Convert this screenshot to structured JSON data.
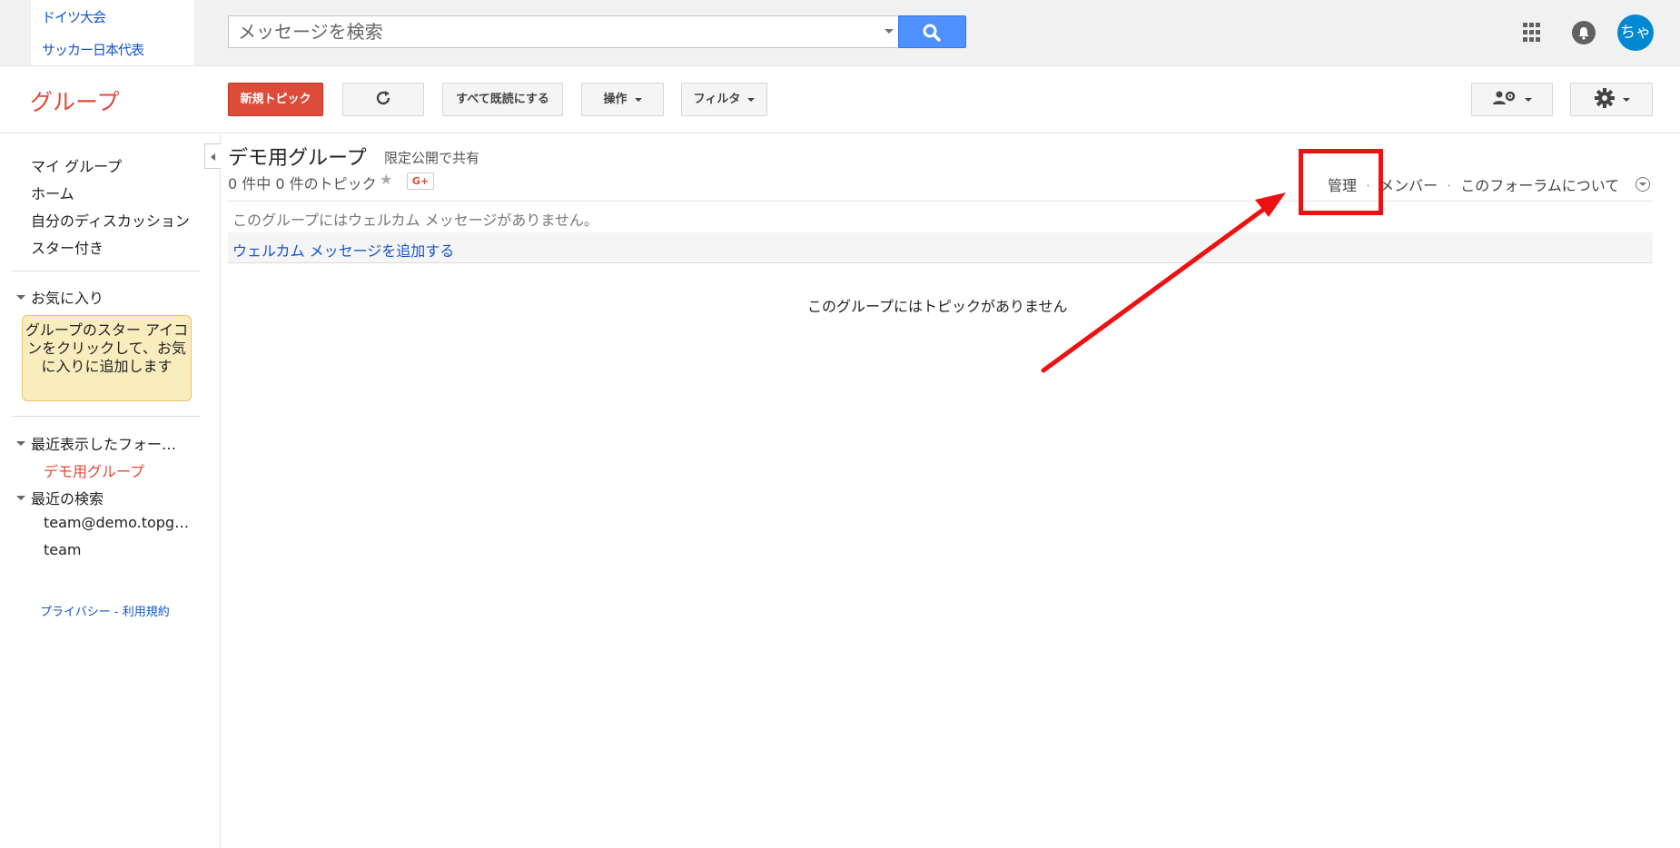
{
  "dropdown": {
    "items": [
      "ドイツ大会",
      "サッカー日本代表"
    ]
  },
  "search": {
    "placeholder": "メッセージを検索"
  },
  "user": {
    "avatar_text": "ちゃ"
  },
  "brand": {
    "title": "グループ"
  },
  "toolbar": {
    "new_topic": "新規トピック",
    "mark_all_read": "すべて既読にする",
    "actions": "操作",
    "filter": "フィルタ"
  },
  "sidebar": {
    "nav": [
      "マイ グループ",
      "ホーム",
      "自分のディスカッション",
      "スター付き"
    ],
    "favorites_header": "お気に入り",
    "favorites_tip": "グループのスター アイコンをクリックして、お気に入りに追加します",
    "recent_forums_header": "最近表示したフォー…",
    "recent_forums": [
      "デモ用グループ"
    ],
    "recent_search_header": "最近の検索",
    "recent_searches": [
      "team@demo.topg…",
      "team"
    ],
    "footer": "プライバシー - 利用規約"
  },
  "group": {
    "name": "デモ用グループ",
    "sharing": "限定公開で共有",
    "topic_count": "0 件中 0 件のトピック",
    "gplus": "G+",
    "links": [
      "管理",
      "メンバー",
      "このフォーラムについて"
    ],
    "welcome_empty": "このグループにはウェルカム メッセージがありません。",
    "add_welcome": "ウェルカム メッセージを追加する",
    "no_topics": "このグループにはトピックがありません"
  },
  "colors": {
    "brand_red": "#dd4b39",
    "search_blue": "#4d90fe",
    "link_blue": "#1155cc",
    "annotation_red": "#ee1111"
  }
}
